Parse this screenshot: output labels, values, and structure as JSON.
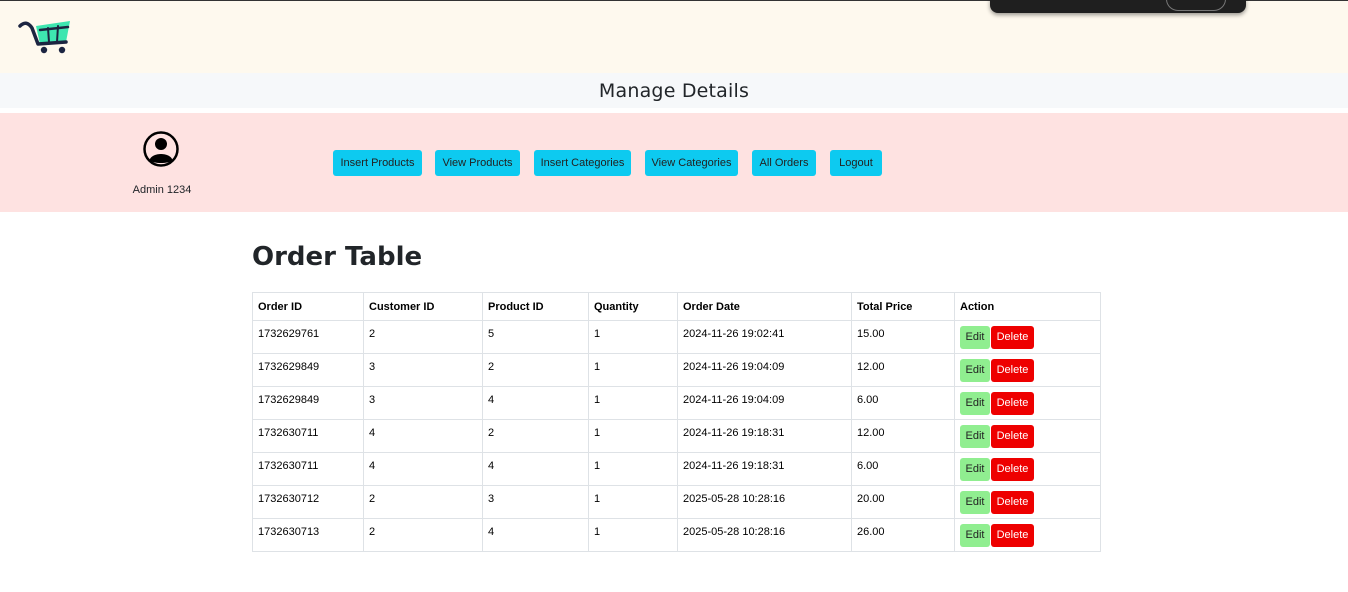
{
  "header": {
    "logo_icon": "shopping-cart-icon",
    "brand_color": "#3ee6b0"
  },
  "manage": {
    "title": "Manage Details"
  },
  "admin": {
    "avatar_icon": "user-circle-icon",
    "name": "Admin 1234"
  },
  "nav": {
    "insert_products": "Insert Products",
    "view_products": "View Products",
    "insert_categories": "Insert Categories",
    "view_categories": "View Categories",
    "all_orders": "All Orders",
    "logout": "Logout"
  },
  "orders": {
    "title": "Order Table",
    "columns": [
      "Order ID",
      "Customer ID",
      "Product ID",
      "Quantity",
      "Order Date",
      "Total Price",
      "Action"
    ],
    "edit_label": "Edit",
    "delete_label": "Delete",
    "rows": [
      [
        "1732629761",
        "2",
        "5",
        "1",
        "2024-11-26 19:02:41",
        "15.00"
      ],
      [
        "1732629849",
        "3",
        "2",
        "1",
        "2024-11-26 19:04:09",
        "12.00"
      ],
      [
        "1732629849",
        "3",
        "4",
        "1",
        "2024-11-26 19:04:09",
        "6.00"
      ],
      [
        "1732630711",
        "4",
        "2",
        "1",
        "2024-11-26 19:18:31",
        "12.00"
      ],
      [
        "1732630711",
        "4",
        "4",
        "1",
        "2024-11-26 19:18:31",
        "6.00"
      ],
      [
        "1732630712",
        "2",
        "3",
        "1",
        "2025-05-28 10:28:16",
        "20.00"
      ],
      [
        "1732630713",
        "2",
        "4",
        "1",
        "2025-05-28 10:28:16",
        "26.00"
      ]
    ]
  },
  "colors": {
    "topbar_bg": "#fef9ee",
    "admin_bar_bg": "#fee2e1",
    "nav_button": "#0dcaf0",
    "edit_button": "#90ee90",
    "delete_button": "#ee0000"
  }
}
